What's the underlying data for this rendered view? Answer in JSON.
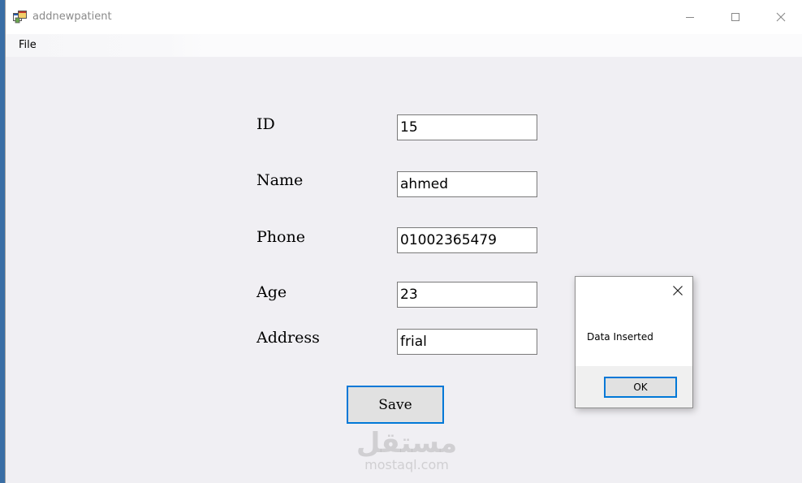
{
  "window": {
    "title": "addnewpatient"
  },
  "menu": {
    "file_label": "File"
  },
  "form": {
    "id_label": "ID",
    "id_value": "15",
    "name_label": "Name",
    "name_value": "ahmed",
    "phone_label": "Phone",
    "phone_value": "01002365479",
    "age_label": "Age",
    "age_value": "23",
    "address_label": "Address",
    "address_value": "frial",
    "save_label": "Save"
  },
  "watermark": {
    "arabic": "مستقل",
    "latin": "mostaql.com"
  },
  "dialog": {
    "message": "Data Inserted",
    "ok_label": "OK"
  },
  "icons": {
    "app": "app-window-icon",
    "minimize": "minimize-icon",
    "maximize": "maximize-icon",
    "close": "close-icon"
  },
  "colors": {
    "accent_border": "#0078d7",
    "form_background": "#f0eff3",
    "desktop": "#3a6ea5"
  }
}
